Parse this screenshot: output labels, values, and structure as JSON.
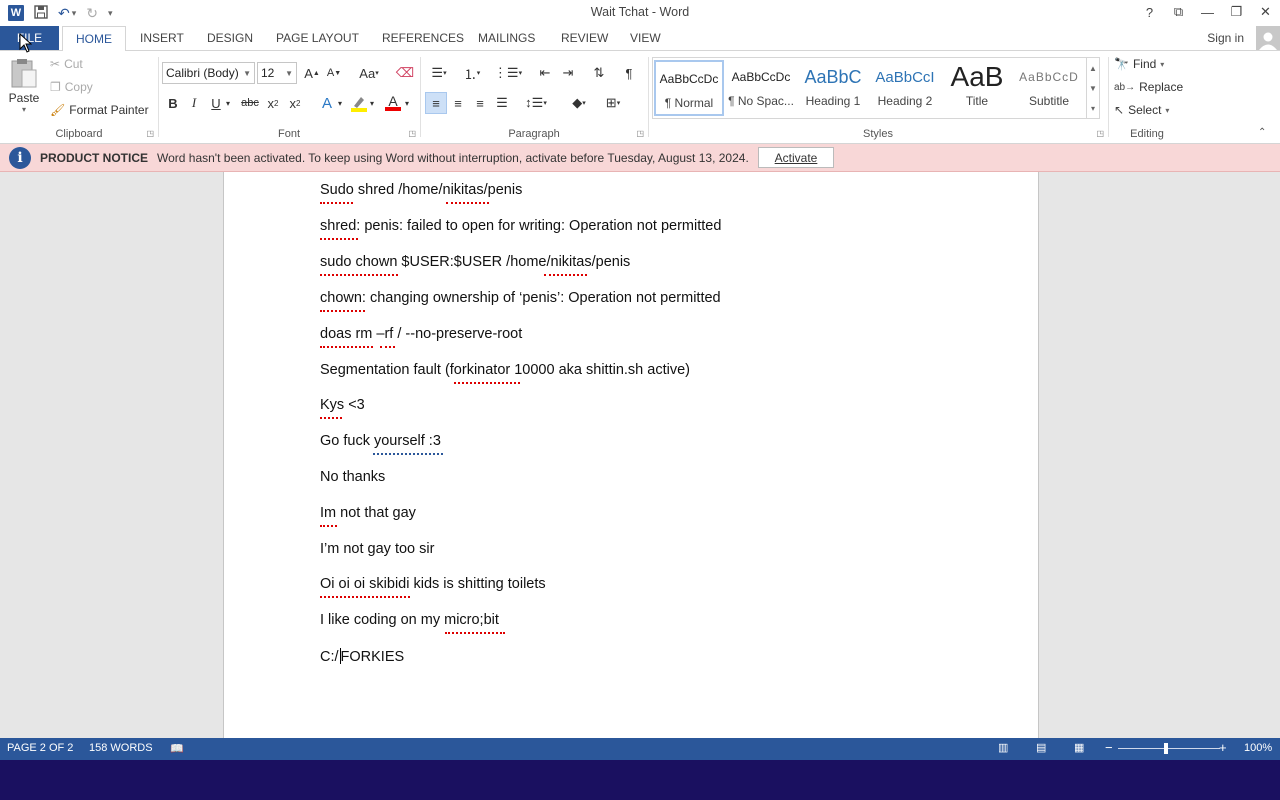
{
  "window": {
    "title": "Wait Tchat - Word",
    "controls": [
      "?",
      "⧉",
      "—",
      "❐",
      "✕"
    ]
  },
  "ribbon_tabs": {
    "file": "FILE",
    "tabs": [
      "HOME",
      "INSERT",
      "DESIGN",
      "PAGE LAYOUT",
      "REFERENCES",
      "MAILINGS",
      "REVIEW",
      "VIEW"
    ],
    "active": "HOME",
    "sign_in": "Sign in"
  },
  "clipboard": {
    "paste": "Paste",
    "cut": "Cut",
    "copy": "Copy",
    "format_painter": "Format Painter",
    "label": "Clipboard"
  },
  "font": {
    "name": "Calibri (Body)",
    "size": "12",
    "label": "Font"
  },
  "paragraph": {
    "label": "Paragraph"
  },
  "styles": {
    "label": "Styles",
    "items": [
      {
        "preview": "AaBbCcDc",
        "name": "¶ Normal"
      },
      {
        "preview": "AaBbCcDc",
        "name": "¶ No Spac..."
      },
      {
        "preview": "AaBbC",
        "name": "Heading 1"
      },
      {
        "preview": "AaBbCcI",
        "name": "Heading 2"
      },
      {
        "preview": "AaB",
        "name": "Title"
      },
      {
        "preview": "AaBbCcD",
        "name": "Subtitle"
      }
    ],
    "selected": "¶ Normal"
  },
  "editing": {
    "find": "Find",
    "replace": "Replace",
    "select": "Select",
    "label": "Editing"
  },
  "notice": {
    "title": "PRODUCT NOTICE",
    "message": "Word hasn't been activated. To keep using Word without interruption, activate before Tuesday, August 13, 2024.",
    "button": "Activate"
  },
  "document": {
    "paragraphs": [
      "Sudo shred /home/nikitas/penis",
      "shred: penis: failed to open for writing: Operation not permitted",
      "sudo chown $USER:$USER /home/nikitas/penis",
      "chown: changing ownership of ‘penis’: Operation not permitted",
      "doas rm –rf / --no-preserve-root",
      "Segmentation fault (forkinator 10000 aka shittin.sh active)",
      "Kys <3",
      "Go fuck yourself :3",
      "No thanks",
      "Im not that gay",
      "I’m not gay too sir",
      "Oi oi oi skibidi kids is shitting toilets",
      "I like coding on my micro;bit"
    ],
    "last_line_before_cursor": "C:/",
    "last_line_after_cursor": "FORKIES"
  },
  "status": {
    "page": "PAGE 2 OF 2",
    "words": "158 WORDS",
    "zoom": "100%",
    "zoom_level": 1.0
  }
}
